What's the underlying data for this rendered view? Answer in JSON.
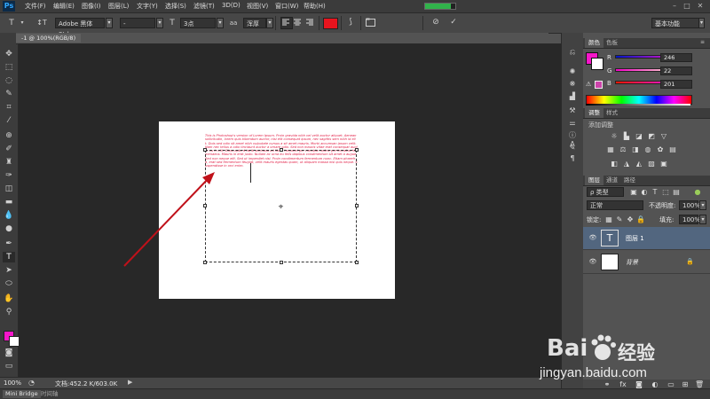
{
  "app": {
    "logo": "Ps",
    "menus": [
      "文件(F)",
      "编辑(E)",
      "图像(I)",
      "图层(L)",
      "文字(Y)",
      "选择(S)",
      "滤镜(T)",
      "3D(D)",
      "视图(V)",
      "窗口(W)",
      "帮助(H)"
    ],
    "progress_fraction": 0.85,
    "window_buttons": [
      "–",
      "□",
      "✕"
    ]
  },
  "options_bar": {
    "tool_icon": "T",
    "orient_icon": "↕T",
    "font_family": "Adobe 黑体 Std",
    "font_style": "-",
    "size_icon": "T",
    "font_size": "3点",
    "aa_icon": "aa",
    "antialias": "浑厚",
    "text_color": "#e8141e",
    "workspace": "基本功能"
  },
  "document": {
    "tab_label": "-1 @ 100%(RGB/8)",
    "lorem_text": "This is Photoshop's version of Lorem Ipsum. Proin gravida nibh vel velit auctor aliquet. Aenean sollicitudin, lorem quis bibendum auctor, nisi elit consequat ipsum, nec sagittis sem nibh id elit. Duis sed odio sit amet nibh vulputate cursus a sit amet mauris. Morbi accumsan ipsum velit. Nam nec tellus a odio tincidunt auctor a ornare odio. Sed non mauris vitae erat consequat auctor eu in elit. Class aptent taciti sociosqu ad litora torquent per conubia nostra, per inceptos himenaeos. Mauris in erat justo. Nullam ac urna eu felis dapibus condimentum sit amet a augue. Sed non neque elit. Sed ut imperdiet nisi. Proin condimentum fermentum nunc. Etiam pharetra, erat sed fermentum feugiat, velit mauris egestas quam, ut aliquam massa nisl quis neque. Suspendisse in orci enim.",
    "lorem_color": "#e0163f",
    "arrow_color": "#c0111a"
  },
  "status": {
    "zoom": "100%",
    "doc_info": "文档:452.2 K/603.0K",
    "bottom_tabs": [
      "Mini Bridge",
      "时间轴"
    ]
  },
  "color_panel": {
    "tabs": [
      "颜色",
      "色板"
    ],
    "foreground": "#f616c9",
    "r_label": "R",
    "r_value": "246",
    "g_label": "G",
    "g_value": "22",
    "b_label": "B",
    "b_value": "201"
  },
  "adjustments_panel": {
    "tabs": [
      "调整",
      "样式"
    ],
    "heading": "添加调整"
  },
  "layers_panel": {
    "tabs": [
      "图层",
      "通道",
      "路径"
    ],
    "filter_label": "ρ 类型",
    "blend_mode": "正常",
    "opacity_label": "不透明度:",
    "opacity_value": "100%",
    "lock_label": "锁定:",
    "fill_label": "填充:",
    "fill_value": "100%",
    "layers": [
      {
        "name": "图层 1",
        "thumb": "T",
        "selected": true
      },
      {
        "name": "背景",
        "thumb": "",
        "selected": false
      }
    ]
  },
  "watermark": {
    "brand": "Bai",
    "brand2": "经验",
    "url": "jingyan.baidu.com"
  }
}
